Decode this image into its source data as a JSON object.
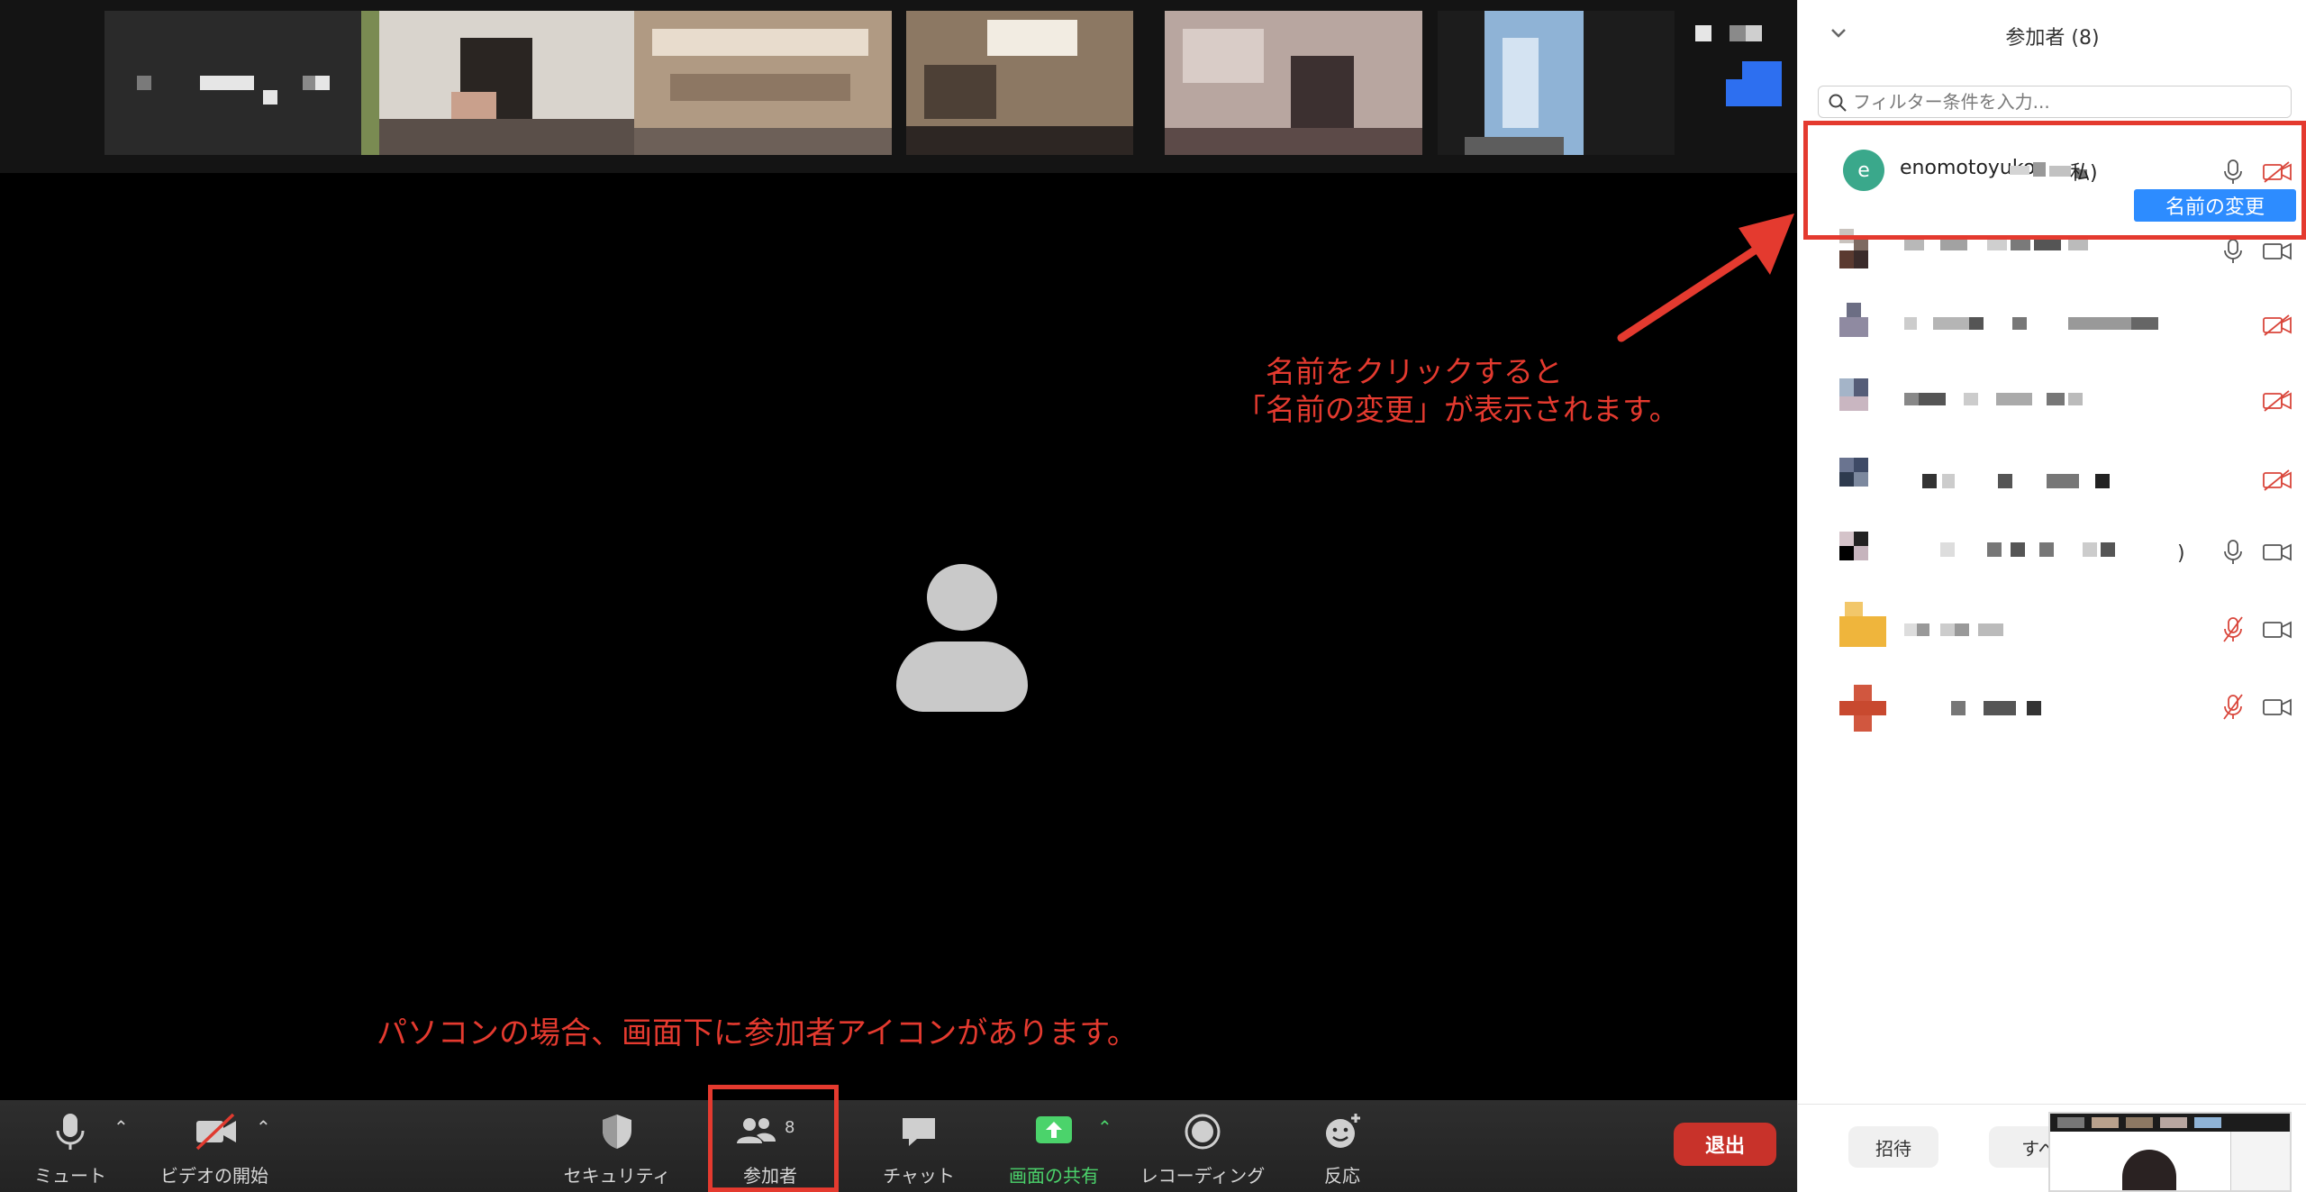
{
  "panel": {
    "title": "参加者 (8)",
    "filter_placeholder": "フィルター条件を入力...",
    "me": {
      "initial": "e",
      "name": "enomotoyuko",
      "suffix": "私)"
    },
    "rename_menu_item": "名前の変更",
    "participant_tail_7": ")",
    "footer": {
      "invite": "招待",
      "all": "すべて"
    }
  },
  "toolbar": {
    "mute": "ミュート",
    "start_video": "ビデオの開始",
    "security": "セキュリティ",
    "participants": "参加者",
    "participants_count": "8",
    "chat": "チャット",
    "share_screen": "画面の共有",
    "recording": "レコーディング",
    "reactions": "反応",
    "leave": "退出"
  },
  "annotations": {
    "right": "　名前をクリックすると\n「名前の変更」が表示されます。",
    "bottom": "パソコンの場合、画面下に参加者アイコンがあります。"
  },
  "colors": {
    "annotation_red": "#e43a2f",
    "share_green": "#4bd36b",
    "leave_red": "#c8322a",
    "avatar_teal": "#3aa88b",
    "menu_blue": "#2d8cff"
  },
  "icons": {
    "mute": "microphone-icon",
    "video": "video-off-icon",
    "security": "shield-icon",
    "participants": "people-icon",
    "chat": "chat-bubble-icon",
    "share": "share-arrow-icon",
    "record": "record-icon",
    "reactions": "smiley-plus-icon"
  }
}
